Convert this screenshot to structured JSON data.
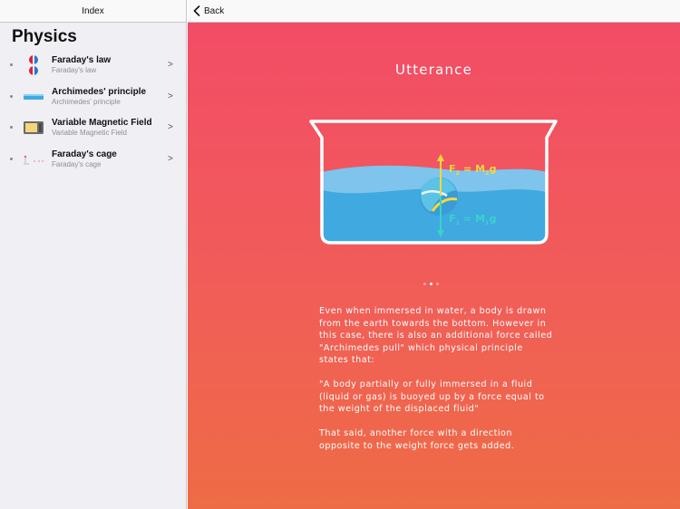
{
  "sidebar": {
    "nav_title": "Index",
    "section_title": "Physics",
    "items": [
      {
        "title": "Faraday's law",
        "subtitle": "Faraday's law",
        "icon": "magnets-icon"
      },
      {
        "title": "Archimedes' principle",
        "subtitle": "Archimedes' principle",
        "icon": "water-tank-icon"
      },
      {
        "title": "Variable Magnetic Field",
        "subtitle": "Variable Magnetic Field",
        "icon": "microwave-icon"
      },
      {
        "title": "Faraday's cage",
        "subtitle": "Faraday's cage",
        "icon": "cage-icon"
      }
    ],
    "chevron": ">"
  },
  "main": {
    "back_label": "Back",
    "heading": "Utterance",
    "diagram": {
      "force_up": "F",
      "force_up_sub": "2",
      "force_up_eq": "= M",
      "force_up_eq_sub": "2",
      "force_up_g": "g",
      "force_down": "F",
      "force_down_sub": "1",
      "force_down_eq": "= M",
      "force_down_eq_sub": "1",
      "force_down_g": "g"
    },
    "page_dots": {
      "count": 3,
      "active": 1
    },
    "paragraphs": [
      "Even when immersed in water, a body is drawn from the earth towards the bottom. However in this case, there is also an additional force called \"Archimedes pull\" which physical principle states that:",
      "\"A body partially or fully immersed in a fluid (liquid or gas) is buoyed up by a force equal to the weight of the displaced fluid\"",
      "That said, another force with a direction opposite to the weight force gets added."
    ]
  },
  "colors": {
    "accent_top": "#f24c66",
    "accent_bottom": "#ee6c45",
    "water": "#3fa9e0",
    "force_up": "#f6d93b",
    "force_down": "#39d3c9"
  }
}
